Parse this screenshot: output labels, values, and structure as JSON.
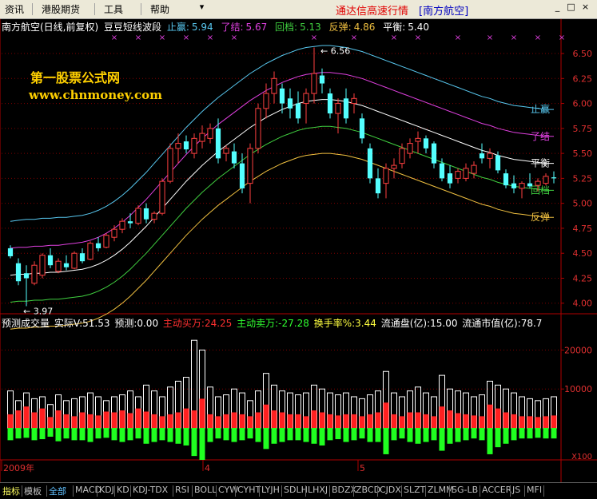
{
  "menu": {
    "items": [
      "资讯",
      "港股期货",
      "工具",
      "帮助"
    ],
    "app_title": "通达信高速行情",
    "stock_title": "[南方航空]",
    "controls": [
      "▾",
      "_",
      "□",
      "×"
    ]
  },
  "price_panel": {
    "title": "南方航空(日线,前复权)",
    "indicator": "豆豆短线波段",
    "lines": [
      {
        "label": "止赢:",
        "value": "5.94",
        "color": "#58c8f0"
      },
      {
        "label": "了结:",
        "value": "5.67",
        "color": "#e040e0"
      },
      {
        "label": "回档:",
        "value": "5.13",
        "color": "#40d040"
      },
      {
        "label": "反弹:",
        "value": "4.86",
        "color": "#f0c040"
      },
      {
        "label": "平衡:",
        "value": "5.40",
        "color": "#ffffff"
      }
    ],
    "right_labels": [
      {
        "text": "止赢",
        "color": "#58c8f0"
      },
      {
        "text": "了结",
        "color": "#e040e0"
      },
      {
        "text": "平衡",
        "color": "#ffffff"
      },
      {
        "text": "回档",
        "color": "#40d040"
      },
      {
        "text": "反弹",
        "color": "#f0c040"
      }
    ],
    "high_label": "6.56",
    "low_label": "3.97",
    "y_ticks": [
      "6.50",
      "6.25",
      "6.00",
      "5.75",
      "5.50",
      "5.25",
      "5.00",
      "4.75",
      "4.50",
      "4.25",
      "4.00"
    ]
  },
  "watermark": {
    "line1": "第一股票公式网",
    "line2": "www.chnmoney.com"
  },
  "volume_panel": {
    "items": [
      {
        "text": "预测成交量",
        "color": "#ffffff"
      },
      {
        "text": "实际V:51.53",
        "color": "#ffffff"
      },
      {
        "text": "预测:0.00",
        "color": "#ffffff"
      },
      {
        "text": "主动买万:24.25",
        "color": "#ff3030"
      },
      {
        "text": "主动卖万:-27.28",
        "color": "#30ff30"
      },
      {
        "text": "换手率%:3.44",
        "color": "#ffff40"
      },
      {
        "text": "流通盘(亿):15.00",
        "color": "#ffffff"
      },
      {
        "text": "流通市值(亿):78.7",
        "color": "#ffffff"
      }
    ],
    "y_ticks": [
      "20000",
      "10000"
    ],
    "unit": "X100"
  },
  "date_axis": {
    "labels": [
      "2009年",
      "4",
      "5"
    ]
  },
  "tabs": [
    "指标",
    "模板",
    "全部",
    "MACD",
    "KDJ",
    "KD",
    "KDJ-TDX",
    "RSI",
    "BOLL",
    "CYW",
    "CYHT",
    "LYJH",
    "SDLH",
    "LHXJ",
    "BDZX",
    "ZBCD",
    "CJDX",
    "SLZT",
    "ZLMM",
    "SG-LB",
    "ACCER",
    "JS",
    "MFI"
  ],
  "chart_data": {
    "type": "candlestick",
    "title": "南方航空(日线,前复权)",
    "ylim": [
      3.95,
      6.7
    ],
    "candles": [
      {
        "o": 4.55,
        "h": 4.58,
        "l": 4.45,
        "c": 4.47
      },
      {
        "o": 4.4,
        "h": 4.45,
        "l": 4.18,
        "c": 4.22
      },
      {
        "o": 4.3,
        "h": 4.38,
        "l": 3.97,
        "c": 4.25
      },
      {
        "o": 4.2,
        "h": 4.42,
        "l": 4.18,
        "c": 4.38
      },
      {
        "o": 4.28,
        "h": 4.5,
        "l": 4.25,
        "c": 4.48
      },
      {
        "o": 4.48,
        "h": 4.55,
        "l": 4.35,
        "c": 4.38
      },
      {
        "o": 4.32,
        "h": 4.45,
        "l": 4.3,
        "c": 4.42
      },
      {
        "o": 4.4,
        "h": 4.48,
        "l": 4.33,
        "c": 4.36
      },
      {
        "o": 4.35,
        "h": 4.52,
        "l": 4.34,
        "c": 4.5
      },
      {
        "o": 4.5,
        "h": 4.55,
        "l": 4.4,
        "c": 4.42
      },
      {
        "o": 4.44,
        "h": 4.62,
        "l": 4.43,
        "c": 4.6
      },
      {
        "o": 4.6,
        "h": 4.66,
        "l": 4.52,
        "c": 4.55
      },
      {
        "o": 4.56,
        "h": 4.7,
        "l": 4.55,
        "c": 4.68
      },
      {
        "o": 4.66,
        "h": 4.78,
        "l": 4.62,
        "c": 4.74
      },
      {
        "o": 4.74,
        "h": 4.85,
        "l": 4.7,
        "c": 4.82
      },
      {
        "o": 4.82,
        "h": 4.9,
        "l": 4.75,
        "c": 4.8
      },
      {
        "o": 4.8,
        "h": 4.98,
        "l": 4.78,
        "c": 4.95
      },
      {
        "o": 4.95,
        "h": 5.0,
        "l": 4.8,
        "c": 4.84
      },
      {
        "o": 4.84,
        "h": 4.92,
        "l": 4.8,
        "c": 4.9
      },
      {
        "o": 4.9,
        "h": 5.25,
        "l": 4.88,
        "c": 5.22
      },
      {
        "o": 5.22,
        "h": 5.6,
        "l": 5.2,
        "c": 5.55
      },
      {
        "o": 5.55,
        "h": 5.7,
        "l": 5.4,
        "c": 5.6
      },
      {
        "o": 5.62,
        "h": 5.68,
        "l": 5.5,
        "c": 5.54
      },
      {
        "o": 5.5,
        "h": 5.7,
        "l": 5.45,
        "c": 5.65
      },
      {
        "o": 5.62,
        "h": 5.78,
        "l": 5.55,
        "c": 5.7
      },
      {
        "o": 5.65,
        "h": 5.8,
        "l": 5.6,
        "c": 5.75
      },
      {
        "o": 5.75,
        "h": 5.85,
        "l": 5.4,
        "c": 5.45
      },
      {
        "o": 5.5,
        "h": 5.58,
        "l": 5.42,
        "c": 5.55
      },
      {
        "o": 5.52,
        "h": 5.6,
        "l": 5.35,
        "c": 5.4
      },
      {
        "o": 5.4,
        "h": 5.5,
        "l": 5.1,
        "c": 5.15
      },
      {
        "o": 5.2,
        "h": 5.6,
        "l": 5.0,
        "c": 5.55
      },
      {
        "o": 5.55,
        "h": 6.0,
        "l": 5.5,
        "c": 5.95
      },
      {
        "o": 5.95,
        "h": 6.2,
        "l": 5.85,
        "c": 6.1
      },
      {
        "o": 6.1,
        "h": 6.32,
        "l": 6.0,
        "c": 6.25
      },
      {
        "o": 6.15,
        "h": 6.2,
        "l": 5.9,
        "c": 6.0
      },
      {
        "o": 6.05,
        "h": 6.15,
        "l": 5.85,
        "c": 5.95
      },
      {
        "o": 6.0,
        "h": 6.12,
        "l": 5.8,
        "c": 5.85
      },
      {
        "o": 6.0,
        "h": 6.15,
        "l": 5.8,
        "c": 6.1
      },
      {
        "o": 6.1,
        "h": 6.56,
        "l": 6.0,
        "c": 6.3
      },
      {
        "o": 6.28,
        "h": 6.35,
        "l": 6.1,
        "c": 6.2
      },
      {
        "o": 6.1,
        "h": 6.15,
        "l": 5.85,
        "c": 5.9
      },
      {
        "o": 5.9,
        "h": 6.05,
        "l": 5.7,
        "c": 6.0
      },
      {
        "o": 6.05,
        "h": 6.15,
        "l": 5.8,
        "c": 5.85
      },
      {
        "o": 6.0,
        "h": 6.1,
        "l": 5.9,
        "c": 6.05
      },
      {
        "o": 5.85,
        "h": 5.9,
        "l": 5.6,
        "c": 5.65
      },
      {
        "o": 5.55,
        "h": 5.6,
        "l": 5.2,
        "c": 5.25
      },
      {
        "o": 5.25,
        "h": 5.35,
        "l": 5.05,
        "c": 5.1
      },
      {
        "o": 5.2,
        "h": 5.4,
        "l": 5.05,
        "c": 5.35
      },
      {
        "o": 5.35,
        "h": 5.45,
        "l": 5.25,
        "c": 5.38
      },
      {
        "o": 5.4,
        "h": 5.6,
        "l": 5.35,
        "c": 5.55
      },
      {
        "o": 5.5,
        "h": 5.65,
        "l": 5.45,
        "c": 5.6
      },
      {
        "o": 5.62,
        "h": 5.72,
        "l": 5.5,
        "c": 5.65
      },
      {
        "o": 5.65,
        "h": 5.68,
        "l": 5.5,
        "c": 5.55
      },
      {
        "o": 5.6,
        "h": 5.62,
        "l": 5.35,
        "c": 5.4
      },
      {
        "o": 5.4,
        "h": 5.45,
        "l": 5.22,
        "c": 5.25
      },
      {
        "o": 5.3,
        "h": 5.38,
        "l": 5.15,
        "c": 5.2
      },
      {
        "o": 5.25,
        "h": 5.35,
        "l": 5.2,
        "c": 5.32
      },
      {
        "o": 5.25,
        "h": 5.4,
        "l": 5.22,
        "c": 5.35
      },
      {
        "o": 5.3,
        "h": 5.42,
        "l": 5.25,
        "c": 5.38
      },
      {
        "o": 5.5,
        "h": 5.6,
        "l": 5.4,
        "c": 5.45
      },
      {
        "o": 5.45,
        "h": 5.55,
        "l": 5.35,
        "c": 5.5
      },
      {
        "o": 5.48,
        "h": 5.52,
        "l": 5.3,
        "c": 5.33
      },
      {
        "o": 5.3,
        "h": 5.34,
        "l": 5.15,
        "c": 5.18
      },
      {
        "o": 5.2,
        "h": 5.28,
        "l": 5.1,
        "c": 5.15
      },
      {
        "o": 5.15,
        "h": 5.22,
        "l": 5.05,
        "c": 5.2
      },
      {
        "o": 5.2,
        "h": 5.3,
        "l": 5.15,
        "c": 5.17
      },
      {
        "o": 5.18,
        "h": 5.25,
        "l": 5.12,
        "c": 5.22
      },
      {
        "o": 5.2,
        "h": 5.3,
        "l": 5.18,
        "c": 5.27
      },
      {
        "o": 5.26,
        "h": 5.32,
        "l": 5.2,
        "c": 5.25
      }
    ],
    "bands": {
      "止赢": {
        "color": "#58c8f0",
        "values": [
          4.82,
          4.83,
          4.84,
          4.84,
          4.85,
          4.85,
          4.86,
          4.86,
          4.87,
          4.88,
          4.9,
          4.93,
          4.97,
          5.02,
          5.08,
          5.15,
          5.23,
          5.31,
          5.4,
          5.49,
          5.58,
          5.67,
          5.76,
          5.84,
          5.92,
          5.99,
          6.06,
          6.12,
          6.18,
          6.24,
          6.3,
          6.35,
          6.4,
          6.44,
          6.48,
          6.51,
          6.54,
          6.56,
          6.57,
          6.58,
          6.58,
          6.57,
          6.56,
          6.54,
          6.52,
          6.49,
          6.46,
          6.43,
          6.4,
          6.37,
          6.34,
          6.31,
          6.28,
          6.25,
          6.22,
          6.19,
          6.16,
          6.13,
          6.1,
          6.07,
          6.05,
          6.02,
          6.0,
          5.98,
          5.97,
          5.96,
          5.95,
          5.94,
          5.94
        ]
      },
      "了结": {
        "color": "#e040e0",
        "values": [
          4.55,
          4.56,
          4.56,
          4.57,
          4.57,
          4.58,
          4.58,
          4.59,
          4.6,
          4.61,
          4.63,
          4.66,
          4.7,
          4.75,
          4.81,
          4.88,
          4.96,
          5.04,
          5.13,
          5.22,
          5.31,
          5.4,
          5.49,
          5.57,
          5.65,
          5.72,
          5.79,
          5.85,
          5.91,
          5.97,
          6.03,
          6.08,
          6.13,
          6.17,
          6.21,
          6.24,
          6.27,
          6.29,
          6.3,
          6.31,
          6.31,
          6.3,
          6.29,
          6.27,
          6.25,
          6.22,
          6.19,
          6.16,
          6.13,
          6.1,
          6.07,
          6.04,
          6.01,
          5.98,
          5.95,
          5.92,
          5.89,
          5.86,
          5.83,
          5.8,
          5.78,
          5.75,
          5.73,
          5.71,
          5.7,
          5.69,
          5.68,
          5.67,
          5.67
        ]
      },
      "平衡": {
        "color": "#ffffff",
        "values": [
          4.28,
          4.29,
          4.29,
          4.3,
          4.3,
          4.31,
          4.31,
          4.32,
          4.33,
          4.34,
          4.36,
          4.39,
          4.43,
          4.48,
          4.54,
          4.61,
          4.69,
          4.77,
          4.86,
          4.95,
          5.04,
          5.13,
          5.22,
          5.3,
          5.38,
          5.45,
          5.52,
          5.58,
          5.64,
          5.7,
          5.76,
          5.81,
          5.86,
          5.9,
          5.94,
          5.97,
          6.0,
          6.02,
          6.03,
          6.04,
          6.04,
          6.03,
          6.02,
          6.0,
          5.98,
          5.95,
          5.92,
          5.89,
          5.86,
          5.83,
          5.8,
          5.77,
          5.74,
          5.71,
          5.68,
          5.65,
          5.62,
          5.59,
          5.56,
          5.53,
          5.51,
          5.48,
          5.46,
          5.44,
          5.43,
          5.42,
          5.41,
          5.4,
          5.4
        ]
      },
      "回档": {
        "color": "#40d040",
        "values": [
          4.01,
          4.02,
          4.02,
          4.03,
          4.03,
          4.04,
          4.04,
          4.05,
          4.06,
          4.07,
          4.09,
          4.12,
          4.16,
          4.21,
          4.27,
          4.34,
          4.42,
          4.5,
          4.59,
          4.68,
          4.77,
          4.86,
          4.95,
          5.03,
          5.11,
          5.18,
          5.25,
          5.31,
          5.37,
          5.43,
          5.49,
          5.54,
          5.59,
          5.63,
          5.67,
          5.7,
          5.73,
          5.75,
          5.76,
          5.77,
          5.77,
          5.76,
          5.75,
          5.73,
          5.71,
          5.68,
          5.65,
          5.62,
          5.59,
          5.56,
          5.53,
          5.5,
          5.47,
          5.44,
          5.41,
          5.38,
          5.35,
          5.32,
          5.29,
          5.26,
          5.24,
          5.21,
          5.19,
          5.17,
          5.16,
          5.15,
          5.14,
          5.13,
          5.13
        ]
      },
      "反弹": {
        "color": "#f0c040",
        "values": [
          3.74,
          3.75,
          3.75,
          3.76,
          3.76,
          3.77,
          3.77,
          3.78,
          3.79,
          3.8,
          3.82,
          3.85,
          3.89,
          3.94,
          4.0,
          4.07,
          4.15,
          4.23,
          4.32,
          4.41,
          4.5,
          4.59,
          4.68,
          4.76,
          4.84,
          4.91,
          4.98,
          5.04,
          5.1,
          5.16,
          5.22,
          5.27,
          5.32,
          5.36,
          5.4,
          5.43,
          5.46,
          5.48,
          5.49,
          5.5,
          5.5,
          5.49,
          5.48,
          5.46,
          5.44,
          5.41,
          5.38,
          5.35,
          5.32,
          5.29,
          5.26,
          5.23,
          5.2,
          5.17,
          5.14,
          5.11,
          5.08,
          5.05,
          5.02,
          4.99,
          4.97,
          4.94,
          4.92,
          4.9,
          4.89,
          4.88,
          4.87,
          4.86,
          4.86
        ]
      }
    },
    "volume": {
      "ylim": [
        0,
        25000
      ],
      "total": [
        9500,
        7000,
        9000,
        7500,
        8000,
        6000,
        8500,
        7000,
        7500,
        8000,
        9000,
        8000,
        7000,
        8000,
        8500,
        9500,
        8000,
        11000,
        9500,
        8000,
        10500,
        12000,
        13000,
        22500,
        20000,
        10500,
        8000,
        8500,
        10000,
        9000,
        7000,
        9500,
        14000,
        11000,
        9500,
        9000,
        8500,
        9000,
        11000,
        10000,
        9000,
        8500,
        9000,
        8000,
        7500,
        8500,
        9500,
        14500,
        9000,
        8000,
        9500,
        10500,
        9000,
        8000,
        13500,
        10000,
        9500,
        9000,
        8000,
        8500,
        12000,
        11000,
        10000,
        9000,
        8000,
        7500,
        7000,
        7500,
        8000
      ],
      "buy": [
        3500,
        4500,
        5500,
        4000,
        5000,
        2800,
        4500,
        3500,
        3000,
        4000,
        3500,
        3200,
        4200,
        4000,
        4500,
        3800,
        5000,
        4200,
        3500,
        3000,
        3500,
        4000,
        5000,
        4500,
        7500,
        3500,
        3000,
        3500,
        4000,
        3500,
        3000,
        4000,
        6000,
        4500,
        4000,
        3500,
        3500,
        3000,
        4500,
        4000,
        3500,
        3200,
        3500,
        3500,
        3000,
        3500,
        4000,
        6500,
        3500,
        3000,
        4000,
        4000,
        3500,
        3000,
        5500,
        4500,
        3800,
        3500,
        3200,
        3000,
        6000,
        5000,
        4000,
        3500,
        3000,
        3000,
        2800,
        3000,
        3200
      ],
      "sell": [
        3500,
        3000,
        2800,
        3500,
        3200,
        2500,
        3800,
        3000,
        3500,
        3500,
        4000,
        3000,
        2800,
        3500,
        4000,
        3500,
        3000,
        4500,
        4000,
        3500,
        4000,
        4500,
        5000,
        8000,
        9500,
        4000,
        3000,
        3500,
        4000,
        3500,
        3000,
        4000,
        6000,
        4500,
        4000,
        3500,
        3500,
        4000,
        4500,
        5000,
        3500,
        3200,
        4000,
        3500,
        3000,
        4000,
        4000,
        7500,
        3500,
        3000,
        4000,
        4500,
        4000,
        3500,
        6500,
        4500,
        4000,
        3500,
        3000,
        3500,
        7500,
        5500,
        4500,
        3500,
        3000,
        3000,
        2800,
        3000,
        3000
      ]
    },
    "x_markers": [
      13,
      16,
      19,
      22,
      25,
      28,
      38,
      43,
      48,
      51,
      56,
      60,
      63,
      66,
      69
    ]
  }
}
